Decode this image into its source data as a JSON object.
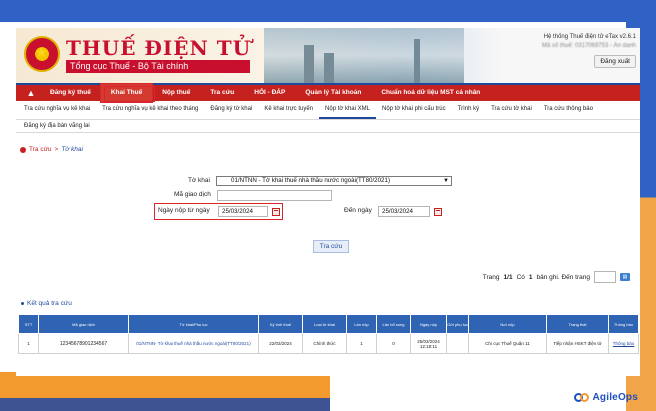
{
  "header": {
    "title": "THUẾ ĐIỆN TỬ",
    "subtitle": "Tổng cục Thuế - Bộ Tài chính",
    "system_name": "Hệ thống Thuế điện tử eTax v2.6.1",
    "user_info": "Mã số thuế: 0317069753 - Ẩn danh",
    "logout_label": "Đăng xuất"
  },
  "mainnav": {
    "items": [
      {
        "label": "Đăng ký thuế"
      },
      {
        "label": "Khai Thuế"
      },
      {
        "label": "Nộp thuế"
      },
      {
        "label": "Tra cứu"
      },
      {
        "label": "HỎI - ĐÁP"
      },
      {
        "label": "Quản lý Tài khoản"
      },
      {
        "label": "Chuẩn hoá dữ liệu MST cá nhân"
      }
    ]
  },
  "subnav": {
    "items": [
      {
        "label": "Tra cứu nghĩa vụ kê khai"
      },
      {
        "label": "Tra cứu nghĩa vụ kê khai theo tháng"
      },
      {
        "label": "Đăng ký tờ khai"
      },
      {
        "label": "Kê khai trực tuyến"
      },
      {
        "label": "Nộp tờ khai XML"
      },
      {
        "label": "Nộp tờ khai phi cấu trúc"
      },
      {
        "label": "Trình ký"
      },
      {
        "label": "Tra cứu tờ khai"
      },
      {
        "label": "Tra cứu thông báo"
      }
    ],
    "row2_label": "Đăng ký địa bàn vãng lai"
  },
  "breadcrumb": {
    "root": "Tra cứu",
    "separator": ">",
    "current": "Tờ khai"
  },
  "form": {
    "to_khai_label": "Tờ khai",
    "to_khai_value": "01/NTNN - Tờ khai thuế nhà thầu nước ngoài(TT80/2021)",
    "ma_giao_dich_label": "Mã giao dịch",
    "ma_giao_dich_value": "",
    "from_date_label": "Ngày nộp từ ngày",
    "from_date_value": "25/03/2024",
    "to_date_label": "Đến ngày",
    "to_date_value": "25/03/2024",
    "search_button": "Tra cứu"
  },
  "pager": {
    "page_label": "Trang",
    "page_value": "1/1",
    "count_prefix": "Có",
    "count_value": "1",
    "count_suffix": "bản ghi. Đến trang",
    "number": "1"
  },
  "results": {
    "title": "Kết quả tra cứu",
    "columns": [
      "STT",
      "Mã giao dịch",
      "Tờ khai/Phụ lục",
      "Kỳ tính thuế",
      "Loại tờ khai",
      "Lần nộp",
      "Lần bổ sung",
      "Ngày nộp",
      "Gửi phụ lục",
      "Nơi nộp",
      "Trạng thái",
      "Thông báo"
    ],
    "rows": [
      {
        "stt": "1",
        "ma_giao_dich": "12345678901234567",
        "to_khai": "01/NTNN- Tờ khai thuế nhà thầu nước ngoài(TT80/2021)",
        "ky_tinh_thue": "22/03/2024",
        "loai_to_khai": "Chính thức",
        "lan_nop": "1",
        "lan_bo_sung": "0",
        "ngay_nop": "25/03/2024 12:18:11",
        "gui_phu_luc": "",
        "noi_nop": "Chi cục Thuế Quận 11",
        "trang_thai": "Tiếp nhận HSKT điện tử",
        "thong_bao": "Thông báo"
      }
    ]
  },
  "brand": {
    "name": "AgileOps"
  },
  "icons": {
    "home": "home-icon",
    "calendar": "calendar-icon",
    "excel": "excel-export-icon"
  },
  "colors": {
    "primary_red": "#c5221f",
    "primary_blue": "#1f4a9c",
    "highlight": "#d9262e",
    "brand_orange": "#f39a2e"
  }
}
